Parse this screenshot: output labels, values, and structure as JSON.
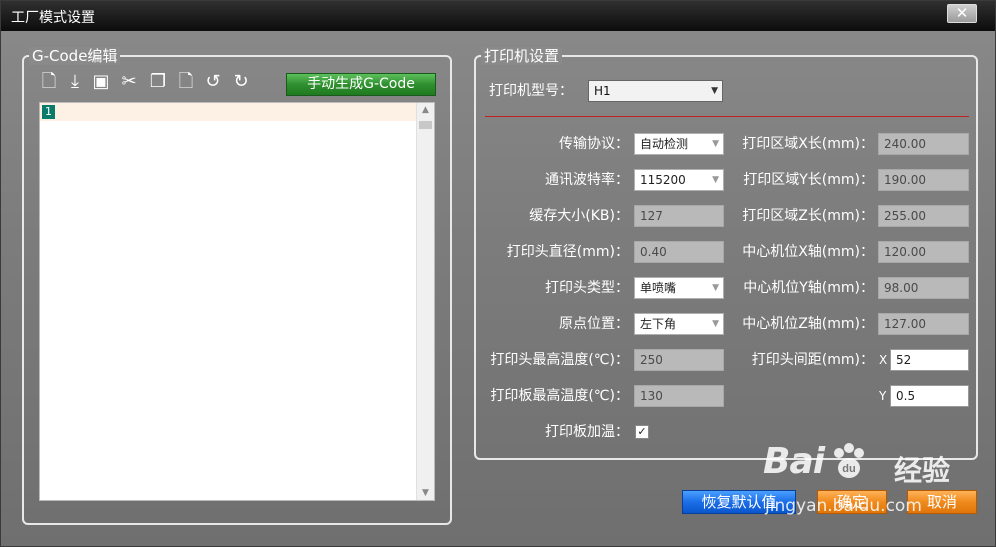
{
  "window": {
    "title": "工厂模式设置",
    "close_label": "✕"
  },
  "gcode": {
    "group_title": "G-Code编辑",
    "toolbar_icons": [
      "new-file-icon",
      "download-icon",
      "save-icon",
      "cut-icon",
      "copy-icon",
      "paste-icon",
      "undo-icon",
      "redo-icon"
    ],
    "generate_button": "手动生成G-Code",
    "line_number": "1"
  },
  "printer": {
    "group_title": "打印机设置",
    "model_label": "打印机型号：",
    "model_value": "H1",
    "left_fields": [
      {
        "label": "传输协议：",
        "value": "自动检测",
        "kind": "combo"
      },
      {
        "label": "通讯波特率：",
        "value": "115200",
        "kind": "combo"
      },
      {
        "label": "缓存大小(KB)：",
        "value": "127",
        "kind": "field"
      },
      {
        "label": "打印头直径(mm)：",
        "value": "0.40",
        "kind": "field"
      },
      {
        "label": "打印头类型：",
        "value": "单喷嘴",
        "kind": "combo"
      },
      {
        "label": "原点位置：",
        "value": "左下角",
        "kind": "combo"
      },
      {
        "label": "打印头最高温度(℃)：",
        "value": "250",
        "kind": "field"
      },
      {
        "label": "打印板最高温度(℃)：",
        "value": "130",
        "kind": "field"
      }
    ],
    "right_fields": [
      {
        "label": "打印区域X长(mm)：",
        "value": "240.00"
      },
      {
        "label": "打印区域Y长(mm)：",
        "value": "190.00"
      },
      {
        "label": "打印区域Z长(mm)：",
        "value": "255.00"
      },
      {
        "label": "中心机位X轴(mm)：",
        "value": "120.00"
      },
      {
        "label": "中心机位Y轴(mm)：",
        "value": "98.00"
      },
      {
        "label": "中心机位Z轴(mm)：",
        "value": "127.00"
      }
    ],
    "head_spacing_label": "打印头间距(mm)：",
    "head_spacing_x_label": "X",
    "head_spacing_x_value": "52",
    "head_spacing_y_label": "Y",
    "head_spacing_y_value": "0.5",
    "bed_heating_label": "打印板加温：",
    "bed_heating_checked": "✓"
  },
  "buttons": {
    "restore": "恢复默认值",
    "ok": "确定",
    "cancel": "取消"
  },
  "watermark": {
    "logo_a": "Bai",
    "logo_b": "经验",
    "url": "jingyan.baidu.com"
  }
}
